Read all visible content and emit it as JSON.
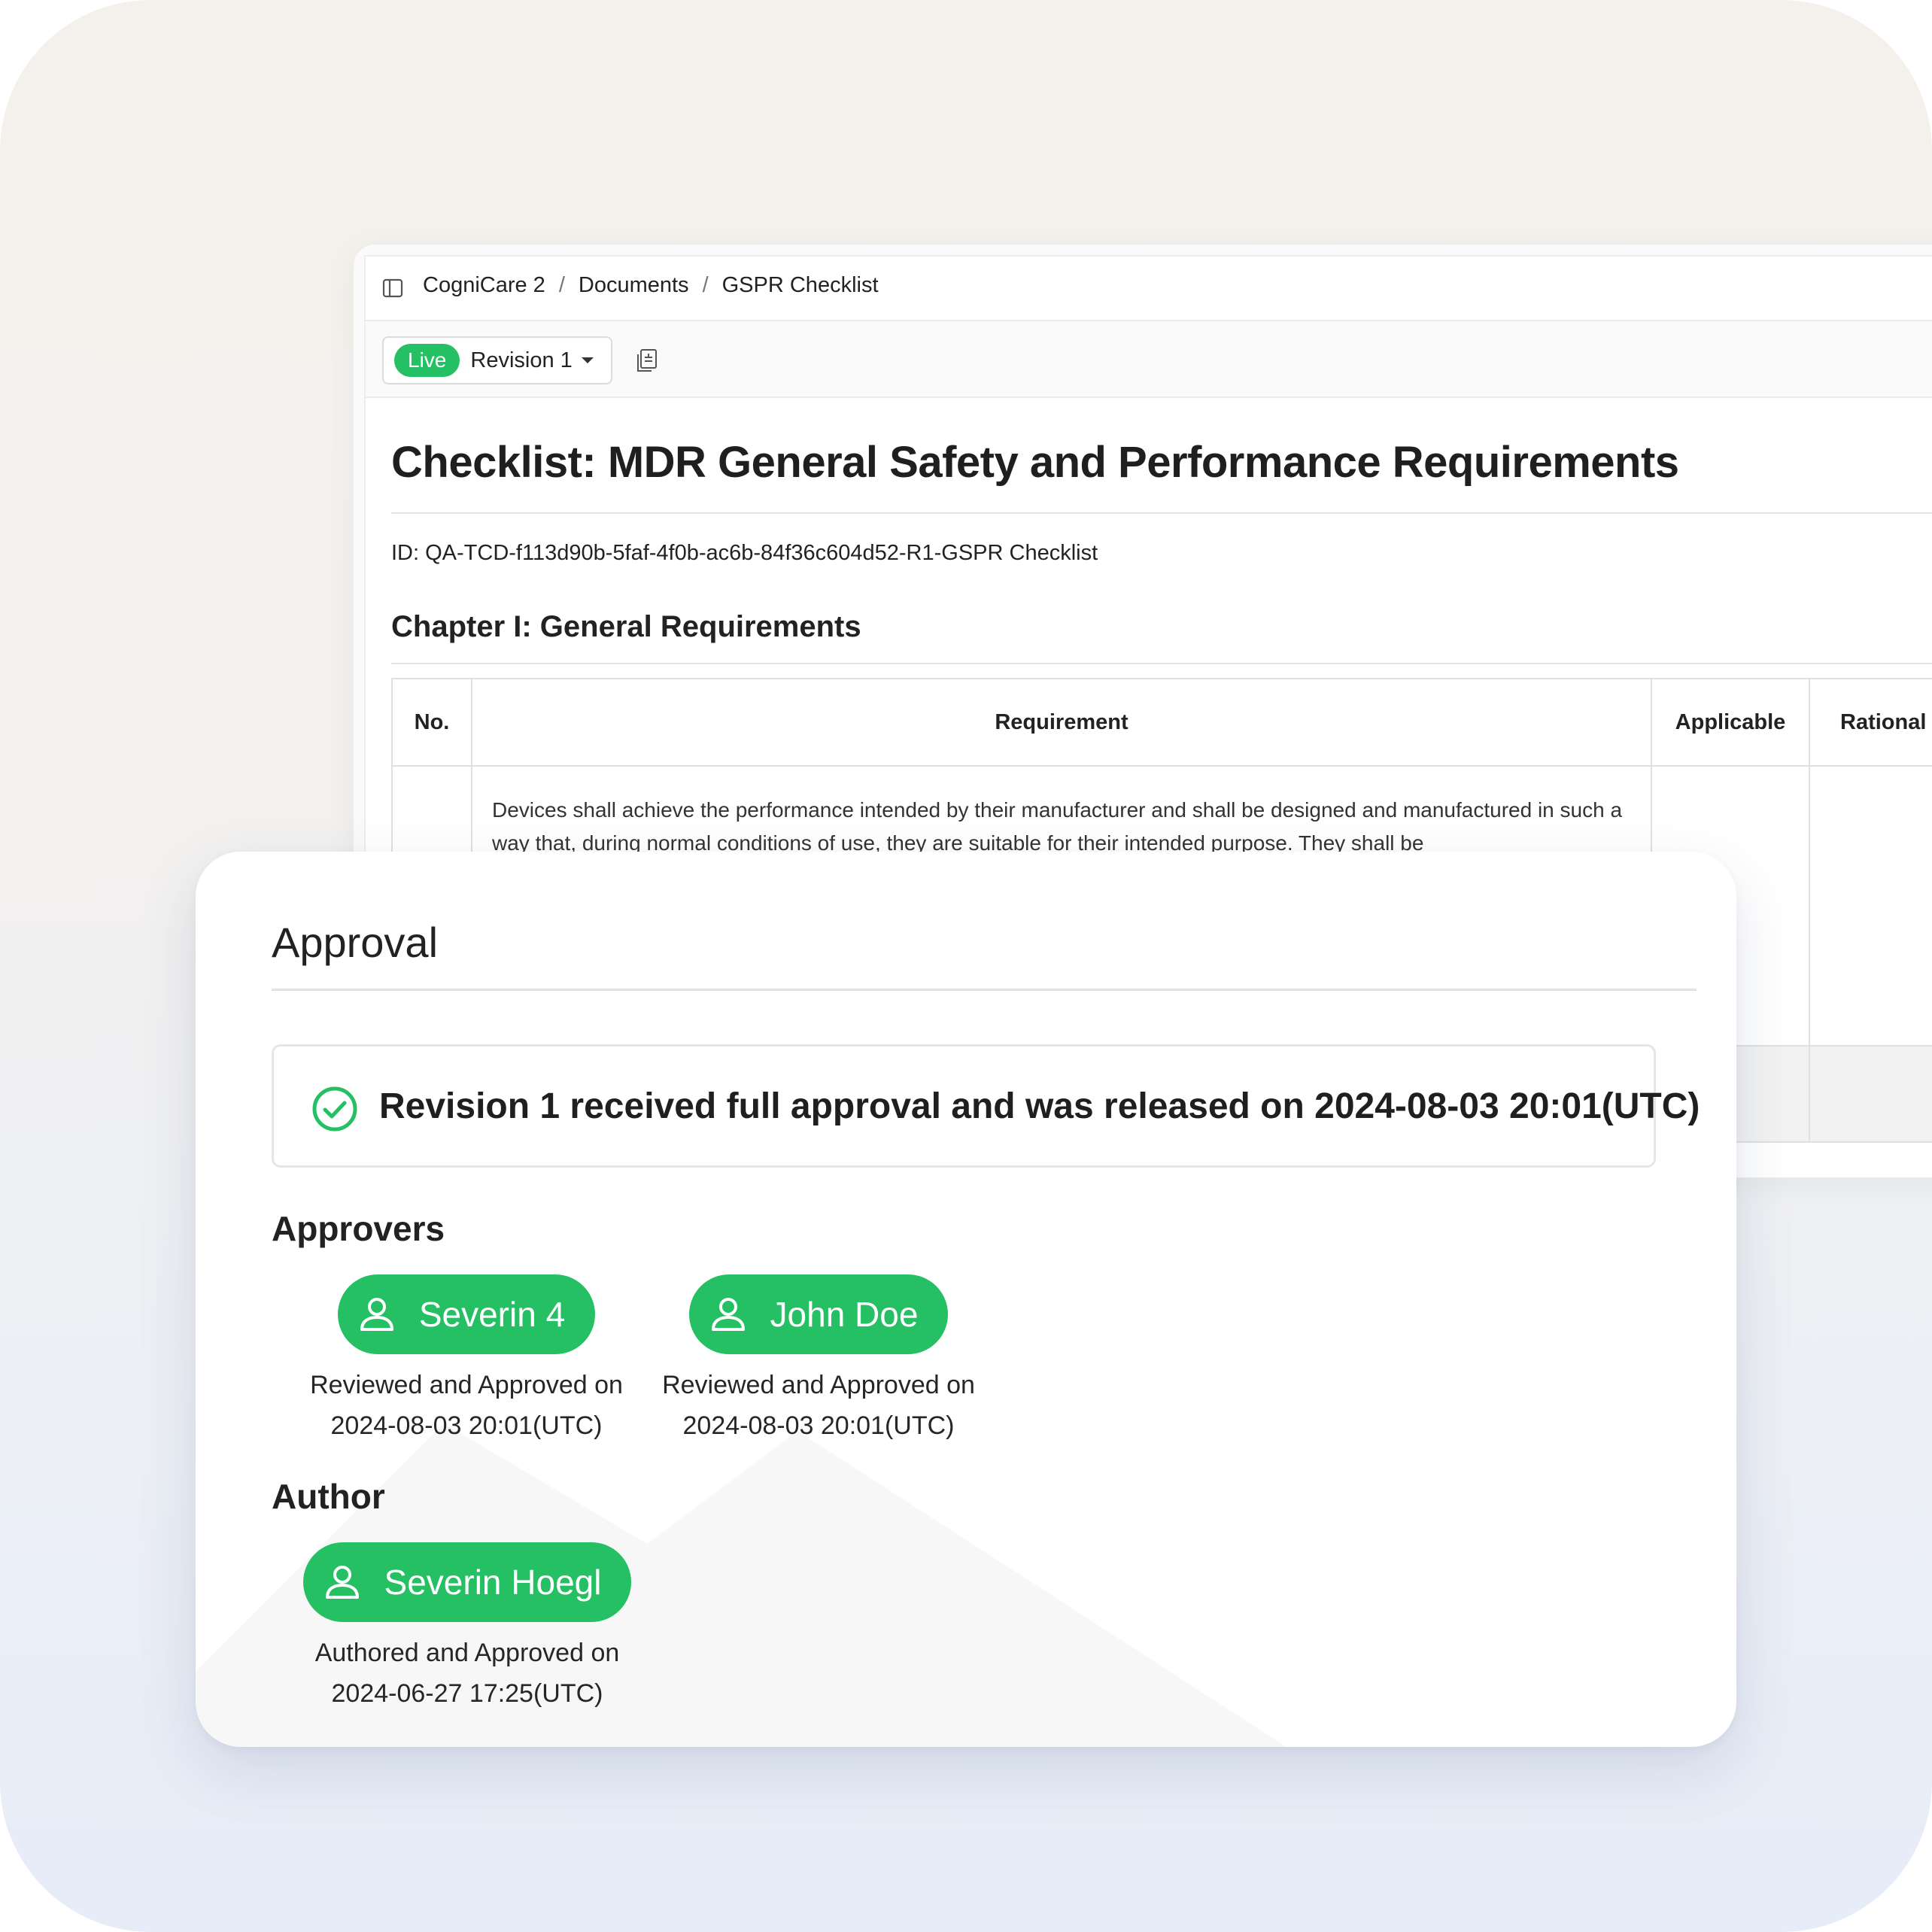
{
  "breadcrumb": {
    "items": [
      "CogniCare 2",
      "Documents",
      "GSPR Checklist"
    ],
    "separator": "/"
  },
  "toolbar": {
    "live_badge": "Live",
    "revision": "Revision 1"
  },
  "document": {
    "title": "Checklist: MDR General Safety and Performance Requirements",
    "id": "ID: QA-TCD-f113d90b-5faf-4f0b-ac6b-84f36c604d52-R1-GSPR Checklist",
    "chapter": "Chapter I: General Requirements",
    "table": {
      "headers": [
        "No.",
        "Requirement",
        "Applicable",
        "Rational"
      ],
      "rows": [
        {
          "no": "",
          "requirement": "Devices shall achieve the performance intended by their manufacturer and shall be designed and manufactured in such a way that, during normal conditions of use, they are suitable for their intended purpose. They shall be",
          "applicable": "",
          "rational": ""
        }
      ]
    }
  },
  "approval": {
    "title": "Approval",
    "release_message": "Revision 1 received full approval and was released on 2024-08-03 20:01(UTC)",
    "approvers_label": "Approvers",
    "approvers": [
      {
        "name": "Severin 4",
        "action": "Reviewed and Approved on",
        "date": "2024-08-03 20:01(UTC)"
      },
      {
        "name": "John Doe",
        "action": "Reviewed and Approved on",
        "date": "2024-08-03 20:01(UTC)"
      }
    ],
    "author_label": "Author",
    "author": {
      "name": "Severin Hoegl",
      "action": "Authored and Approved on",
      "date": "2024-06-27 17:25(UTC)"
    }
  },
  "colors": {
    "accent_green": "#25c063",
    "text": "#1f1f1f",
    "border": "#e0e0e0"
  },
  "icons": [
    "sidebar-toggle-icon",
    "copy-document-icon",
    "check-circle-icon",
    "user-icon"
  ]
}
